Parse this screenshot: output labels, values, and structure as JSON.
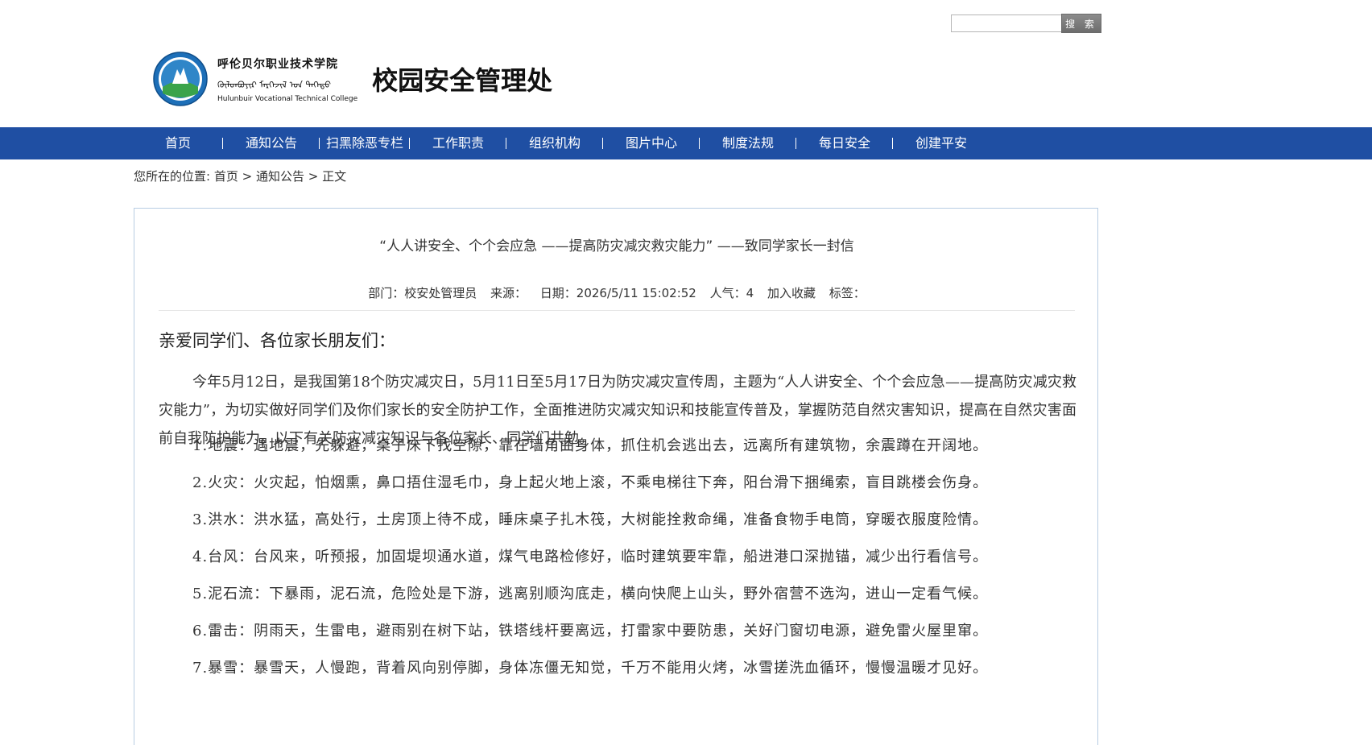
{
  "search": {
    "placeholder": "",
    "button_label": "搜 索"
  },
  "header": {
    "college_cn": "呼伦贝尔职业技术学院",
    "college_mong": "ᠬᠥᠯᠥᠨᠪᠤᠶᠢᠷ ᠮᠡᠷᠭᠡᠵᠢᠯ ᠤᠨ ᠳᠡᠭᠡᠳᠦ",
    "college_en": "Hulunbuir Vocational Technical College",
    "dept_title": "校园安全管理处"
  },
  "nav": {
    "items": [
      {
        "label": "首页"
      },
      {
        "label": "通知公告"
      },
      {
        "label": "扫黑除恶专栏"
      },
      {
        "label": "工作职责"
      },
      {
        "label": "组织机构"
      },
      {
        "label": "图片中心"
      },
      {
        "label": "制度法规"
      },
      {
        "label": "每日安全"
      },
      {
        "label": "创建平安"
      }
    ]
  },
  "breadcrumb": {
    "prefix": "您所在的位置:",
    "home": "首页",
    "sep1": " > ",
    "section": "通知公告",
    "sep2": " > ",
    "current": "正文"
  },
  "article": {
    "title": "“人人讲安全、个个会应急 ——提高防灾减灾救灾能力” ——致同学家长一封信",
    "meta": {
      "dept": "部门：校安处管理员",
      "source": "来源：",
      "date": "日期：2026/5/11 15:02:52",
      "views": "人气：4",
      "favorite": "加入收藏",
      "tags": "标签："
    },
    "greeting": "亲爱同学们、各位家长朋友们：",
    "intro": "今年5月12日，是我国第18个防灾减灾日，5月11日至5月17日为防灾减灾宣传周，主题为“人人讲安全、个个会应急——提高防灾减灾救灾能力”，为切实做好同学们及你们家长的安全防护工作，全面推进防灾减灾知识和技能宣传普及，掌握防范自然灾害知识，提高在自然灾害面前自我防护能力。以下有关防灾减灾知识与各位家长、同学们共勉。",
    "items": [
      "1.地震：遇地震，先躲避，桌子床下找空隙，靠在墙角曲身体，抓住机会逃出去，远离所有建筑物，余震蹲在开阔地。",
      "2.火灾：火灾起，怕烟熏，鼻口捂住湿毛巾，身上起火地上滚，不乘电梯往下奔，阳台滑下捆绳索，盲目跳楼会伤身。",
      "3.洪水：洪水猛，高处行，土房顶上待不成，睡床桌子扎木筏，大树能拴救命绳，准备食物手电筒，穿暖衣服度险情。",
      "4.台风：台风来，听预报，加固堤坝通水道，煤气电路检修好，临时建筑要牢靠，船进港口深抛锚，减少出行看信号。",
      "5.泥石流：下暴雨，泥石流，危险处是下游，逃离别顺沟底走，横向快爬上山头，野外宿营不选沟，进山一定看气候。",
      "6.雷击：阴雨天，生雷电，避雨别在树下站，铁塔线杆要离远，打雷家中要防患，关好门窗切电源，避免雷火屋里窜。",
      "7.暴雪：暴雪天，人慢跑，背着风向别停脚，身体冻僵无知觉，千万不能用火烤，冰雪搓洗血循环，慢慢温暖才见好。"
    ]
  },
  "colors": {
    "nav_bg": "#1f4fa3",
    "box_border": "#b8cde3"
  }
}
